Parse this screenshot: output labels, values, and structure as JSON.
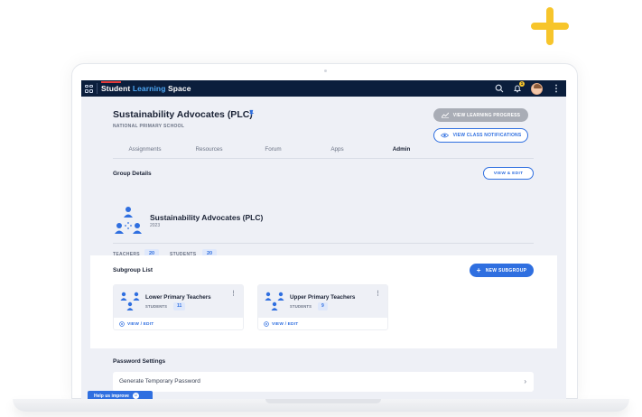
{
  "colors": {
    "navbar": "#0b1e3c",
    "primary": "#2f6fe0",
    "accent_plus": "#f7c52b",
    "brand_accent": "#4ea8f5"
  },
  "navbar": {
    "brand_part1": "Student",
    "brand_part2": "Learning",
    "brand_part3": "Space",
    "icons": [
      "apps-grid-icon",
      "search-icon",
      "bell-icon",
      "avatar",
      "kebab-menu-icon"
    ],
    "notification_count": "1"
  },
  "header": {
    "title": "Sustainability Advocates (PLC)",
    "school": "NATIONAL PRIMARY SCHOOL",
    "view_progress_label": "VIEW LEARNING PROGRESS",
    "view_notifications_label": "VIEW CLASS NOTIFICATIONS"
  },
  "tabs": [
    {
      "label": "Assignments",
      "active": false
    },
    {
      "label": "Resources",
      "active": false
    },
    {
      "label": "Forum",
      "active": false
    },
    {
      "label": "Apps",
      "active": false
    },
    {
      "label": "Admin",
      "active": true
    }
  ],
  "group_details": {
    "heading": "Group Details",
    "view_edit_label": "VIEW & EDIT",
    "name": "Sustainability Advocates (PLC)",
    "year": "2023",
    "teachers_label": "TEACHERS",
    "teachers_count": "20",
    "students_label": "STUDENTS",
    "students_count": "20"
  },
  "subgroups": {
    "heading": "Subgroup List",
    "new_label": "NEW SUBGROUP",
    "items": [
      {
        "name": "Lower Primary Teachers",
        "students_label": "STUDENTS",
        "count": "11",
        "link": "VIEW / EDIT"
      },
      {
        "name": "Upper Primary Teachers",
        "students_label": "STUDENTS",
        "count": "9",
        "link": "VIEW / EDIT"
      }
    ]
  },
  "password": {
    "heading": "Password Settings",
    "row_label": "Generate Temporary Password"
  },
  "help": {
    "label": "Help us improve"
  }
}
